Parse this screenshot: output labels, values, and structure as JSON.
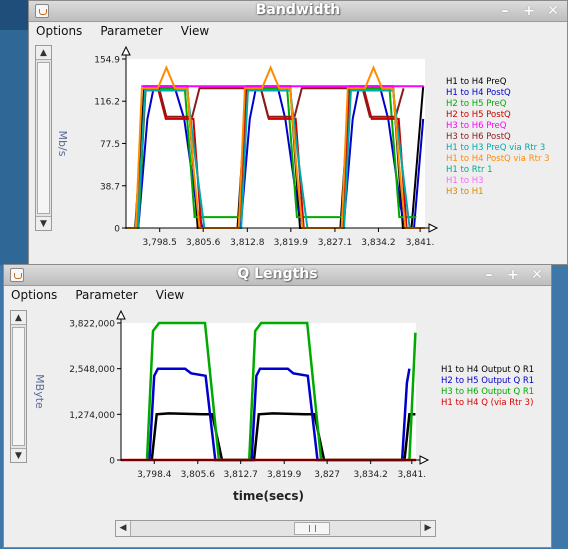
{
  "window1": {
    "title": "Bandwidth",
    "menu": [
      "Options",
      "Parameter",
      "View"
    ],
    "buttons": [
      "–",
      "+",
      "✕"
    ]
  },
  "window2": {
    "title": "Q Lengths",
    "menu": [
      "Options",
      "Parameter",
      "View"
    ],
    "buttons": [
      "–",
      "+",
      "✕"
    ]
  },
  "chart_data": [
    {
      "type": "line",
      "title": "",
      "xlabel": "",
      "ylabel": "Mb/s",
      "ylim": [
        0,
        154.9
      ],
      "xlim": [
        3793,
        3841.8
      ],
      "yticks": [
        "154.9",
        "116.2",
        "77.5",
        "38.7",
        "0"
      ],
      "ytick_values": [
        154.9,
        116.2,
        77.5,
        38.7,
        0
      ],
      "xticks": [
        "3,798.5",
        "3,805.6",
        "3,812.8",
        "3,819.9",
        "3,827.1",
        "3,834.2",
        "3,841."
      ],
      "xtick_values": [
        3798.5,
        3805.6,
        3812.8,
        3819.9,
        3827.1,
        3834.2,
        3841
      ],
      "legend_position": "right",
      "series": [
        {
          "name": "H1 to H4 PreQ",
          "color": "#000000",
          "points": [
            [
              3793,
              0
            ],
            [
              3794.5,
              0
            ],
            [
              3796,
              130
            ],
            [
              3803,
              130
            ],
            [
              3804.7,
              0
            ],
            [
              3811.2,
              0
            ],
            [
              3812.7,
              130
            ],
            [
              3819.8,
              130
            ],
            [
              3821.4,
              0
            ],
            [
              3828,
              0
            ],
            [
              3829.5,
              130
            ],
            [
              3836.6,
              130
            ],
            [
              3838.2,
              0
            ],
            [
              3839.6,
              0
            ],
            [
              3841.5,
              130
            ]
          ]
        },
        {
          "name": "H1 to H4 PostQ",
          "color": "#0000cc",
          "points": [
            [
              3793,
              0
            ],
            [
              3795,
              0
            ],
            [
              3796.5,
              100
            ],
            [
              3797.5,
              128
            ],
            [
              3801,
              128
            ],
            [
              3802.5,
              100
            ],
            [
              3804.5,
              20
            ],
            [
              3805.5,
              0
            ],
            [
              3811.7,
              0
            ],
            [
              3813.2,
              100
            ],
            [
              3814.2,
              128
            ],
            [
              3817.8,
              128
            ],
            [
              3819,
              100
            ],
            [
              3821,
              20
            ],
            [
              3822,
              0
            ],
            [
              3828.5,
              0
            ],
            [
              3830,
              100
            ],
            [
              3831,
              128
            ],
            [
              3834.5,
              128
            ],
            [
              3835.8,
              100
            ],
            [
              3837.8,
              20
            ],
            [
              3838.6,
              0
            ],
            [
              3840,
              0
            ],
            [
              3841.5,
              100
            ]
          ]
        },
        {
          "name": "H2 to H5 PreQ",
          "color": "#00aa00",
          "points": [
            [
              3793,
              0
            ],
            [
              3795,
              0
            ],
            [
              3796.2,
              128
            ],
            [
              3802.6,
              128
            ],
            [
              3804.2,
              10
            ],
            [
              3811.6,
              10
            ],
            [
              3812.9,
              128
            ],
            [
              3819.3,
              128
            ],
            [
              3820.9,
              10
            ],
            [
              3828.4,
              10
            ],
            [
              3829.6,
              128
            ],
            [
              3836,
              128
            ],
            [
              3837.6,
              10
            ],
            [
              3840.4,
              10
            ]
          ]
        },
        {
          "name": "H2 to H5 PostQ",
          "color": "#cc0000",
          "points": [
            [
              3793,
              0
            ],
            [
              3794.8,
              0
            ],
            [
              3796.2,
              128
            ],
            [
              3798.2,
              128
            ],
            [
              3799.5,
              100
            ],
            [
              3804,
              100
            ],
            [
              3805.3,
              0
            ],
            [
              3811.4,
              0
            ],
            [
              3812.8,
              128
            ],
            [
              3815,
              128
            ],
            [
              3816.3,
              100
            ],
            [
              3820.7,
              100
            ],
            [
              3822,
              0
            ],
            [
              3828.2,
              0
            ],
            [
              3829.6,
              128
            ],
            [
              3831.8,
              128
            ],
            [
              3833.1,
              100
            ],
            [
              3837.5,
              100
            ],
            [
              3838.8,
              0
            ]
          ]
        },
        {
          "name": "H3 to H6 PreQ",
          "color": "#ff00ff",
          "points": [
            [
              3795.5,
              130
            ],
            [
              3841.6,
              130
            ]
          ]
        },
        {
          "name": "H3 to H6 PostQ",
          "color": "#8b1a1a",
          "points": [
            [
              3796.8,
              128
            ],
            [
              3798.4,
              128
            ],
            [
              3799.6,
              102
            ],
            [
              3803.8,
              102
            ],
            [
              3805,
              128
            ],
            [
              3813.5,
              128
            ],
            [
              3815,
              128
            ],
            [
              3816.2,
              102
            ],
            [
              3820.5,
              102
            ],
            [
              3821.7,
              128
            ],
            [
              3830,
              128
            ],
            [
              3831.6,
              128
            ],
            [
              3832.8,
              102
            ],
            [
              3837,
              102
            ],
            [
              3838.3,
              128
            ]
          ]
        },
        {
          "name": "H1 to H3 PreQ via Rtr 3",
          "color": "#00aaaa",
          "points": [
            [
              3793,
              0
            ],
            [
              3794.9,
              0
            ],
            [
              3796.1,
              126
            ],
            [
              3803,
              126
            ],
            [
              3804.4,
              60
            ],
            [
              3805.8,
              0
            ],
            [
              3811.8,
              0
            ],
            [
              3812.9,
              126
            ],
            [
              3819.8,
              126
            ],
            [
              3821.2,
              60
            ],
            [
              3822.6,
              0
            ],
            [
              3828.6,
              0
            ],
            [
              3829.7,
              126
            ],
            [
              3836.6,
              126
            ],
            [
              3838,
              60
            ],
            [
              3839.3,
              0
            ]
          ]
        },
        {
          "name": "H1 to H4 PostQ via Rtr 3",
          "color": "#ff8c00",
          "points": [
            [
              3793,
              0
            ],
            [
              3794.6,
              0
            ],
            [
              3795.6,
              128
            ],
            [
              3798.2,
              128
            ],
            [
              3799.6,
              147
            ],
            [
              3801,
              128
            ],
            [
              3803,
              128
            ],
            [
              3804.1,
              50
            ],
            [
              3805,
              0
            ],
            [
              3811.4,
              0
            ],
            [
              3812.4,
              128
            ],
            [
              3815.2,
              128
            ],
            [
              3816.6,
              147
            ],
            [
              3818,
              128
            ],
            [
              3819.8,
              128
            ],
            [
              3820.9,
              50
            ],
            [
              3821.8,
              0
            ],
            [
              3828.2,
              0
            ],
            [
              3829.2,
              128
            ],
            [
              3832,
              128
            ],
            [
              3833.4,
              147
            ],
            [
              3834.8,
              128
            ],
            [
              3836.6,
              128
            ],
            [
              3837.7,
              50
            ],
            [
              3838.6,
              0
            ],
            [
              3841.8,
              0
            ]
          ]
        },
        {
          "name": "H1 to Rtr 1",
          "color": "#00aa88",
          "points": []
        },
        {
          "name": "H1 to H3",
          "color": "#ff66ff",
          "points": []
        },
        {
          "name": "H3 to H1",
          "color": "#dd8800",
          "points": []
        }
      ]
    },
    {
      "type": "line",
      "title": "",
      "xlabel": "time(secs)",
      "ylabel": "MByte",
      "ylim": [
        0,
        3822000
      ],
      "xlim": [
        3792.9,
        3841.7
      ],
      "yticks": [
        "3,822,000",
        "2,548,000",
        "1,274,000",
        "0"
      ],
      "ytick_values": [
        3822000,
        2548000,
        1274000,
        0
      ],
      "xticks": [
        "3,798.4",
        "3,805.6",
        "3,812.7",
        "3,819.9",
        "3,827",
        "3,834.2",
        "3,841."
      ],
      "xtick_values": [
        3798.4,
        3805.6,
        3812.7,
        3819.9,
        3827,
        3834.2,
        3841
      ],
      "legend_position": "right",
      "series": [
        {
          "name": "H1 to H4 Output Q R1",
          "color": "#000000",
          "points": [
            [
              3798,
              0
            ],
            [
              3798.8,
              1274000
            ],
            [
              3800.8,
              1300000
            ],
            [
              3806.4,
              1274000
            ],
            [
              3808,
              1274000
            ],
            [
              3809.6,
              0
            ],
            [
              3814.9,
              0
            ],
            [
              3815.7,
              1274000
            ],
            [
              3818,
              1300000
            ],
            [
              3823.3,
              1274000
            ],
            [
              3824.9,
              1274000
            ],
            [
              3826.5,
              0
            ],
            [
              3839.8,
              0
            ],
            [
              3840.6,
              1274000
            ],
            [
              3841.6,
              1274000
            ]
          ]
        },
        {
          "name": "H2 to H5 Output Q R1",
          "color": "#0000cc",
          "points": [
            [
              3797.6,
              0
            ],
            [
              3798.4,
              2350000
            ],
            [
              3799,
              2548000
            ],
            [
              3803.5,
              2548000
            ],
            [
              3804.5,
              2420000
            ],
            [
              3806.9,
              2350000
            ],
            [
              3808.5,
              0
            ],
            [
              3814.5,
              0
            ],
            [
              3815.3,
              2350000
            ],
            [
              3815.9,
              2548000
            ],
            [
              3820.5,
              2548000
            ],
            [
              3821.4,
              2420000
            ],
            [
              3823.8,
              2350000
            ],
            [
              3825.4,
              0
            ],
            [
              3839.4,
              0
            ],
            [
              3840.2,
              2150000
            ],
            [
              3840.6,
              2548000
            ]
          ]
        },
        {
          "name": "H3 to H6 Output Q R1",
          "color": "#00aa00",
          "points": [
            [
              3797.2,
              0
            ],
            [
              3798.2,
              3600000
            ],
            [
              3799.2,
              3822000
            ],
            [
              3805.3,
              3822000
            ],
            [
              3806.8,
              3822000
            ],
            [
              3809.1,
              0
            ],
            [
              3814.1,
              0
            ],
            [
              3815.1,
              3600000
            ],
            [
              3816.1,
              3822000
            ],
            [
              3822.2,
              3822000
            ],
            [
              3823.7,
              3822000
            ],
            [
              3826,
              0
            ],
            [
              3840.6,
              0
            ],
            [
              3841.6,
              3550000
            ]
          ]
        },
        {
          "name": "H1 to H4 Q (via Rtr 3)",
          "color": "#dd0000",
          "points": [
            [
              3792.9,
              0
            ],
            [
              3841.7,
              0
            ]
          ]
        }
      ]
    }
  ]
}
